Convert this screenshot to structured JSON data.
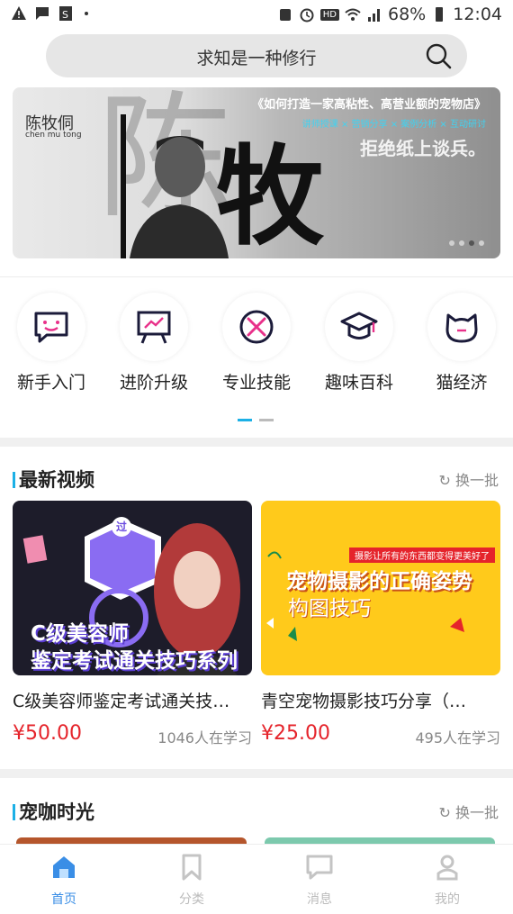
{
  "status_bar": {
    "battery": "68%",
    "time": "12:04",
    "hd": "HD"
  },
  "search": {
    "placeholder": "求知是一种修行"
  },
  "banner": {
    "name": "陈牧侗",
    "pinyin": "chen mu tong",
    "big_text": "陈",
    "big_text2": "牧",
    "headline": "《如何打造一家高粘性、高营业额的宠物店》",
    "subline": "讲师授课 × 营销分享 × 案例分析 × 互动研讨",
    "tagline": "拒绝纸上谈兵。",
    "dots": 4,
    "active_dot": 3
  },
  "categories": [
    {
      "label": "新手入门",
      "icon": "chat-smile-icon"
    },
    {
      "label": "进阶升级",
      "icon": "presentation-board-icon"
    },
    {
      "label": "专业技能",
      "icon": "tools-icon"
    },
    {
      "label": "趣味百科",
      "icon": "graduation-cap-icon"
    },
    {
      "label": "猫经济",
      "icon": "cat-face-icon"
    }
  ],
  "latest_videos": {
    "title": "最新视频",
    "refresh": "换一批",
    "items": [
      {
        "thumb_line1": "C级美容师",
        "thumb_line2": "鉴定考试通关技巧系列",
        "thumb_badge": "过",
        "title": "C级美容师鉴定考试通关技…",
        "price": "¥50.00",
        "learners": "1046人在学习"
      },
      {
        "thumb_ribbon": "摄影让所有的东西都变得更美好了",
        "thumb_line1": "宠物摄影的正确姿势",
        "thumb_line2": "构图技巧",
        "title": "青空宠物摄影技巧分享（…",
        "price": "¥25.00",
        "learners": "495人在学习"
      }
    ]
  },
  "pet_cafe": {
    "title": "宠咖时光",
    "refresh": "换一批"
  },
  "nav": [
    {
      "label": "首页",
      "icon": "home-icon",
      "active": true
    },
    {
      "label": "分类",
      "icon": "bookmark-icon",
      "active": false
    },
    {
      "label": "消息",
      "icon": "message-icon",
      "active": false
    },
    {
      "label": "我的",
      "icon": "person-icon",
      "active": false
    }
  ],
  "colors": {
    "accent": "#1cb0e6",
    "price": "#e5242b",
    "nav_active": "#3a8ee6"
  }
}
